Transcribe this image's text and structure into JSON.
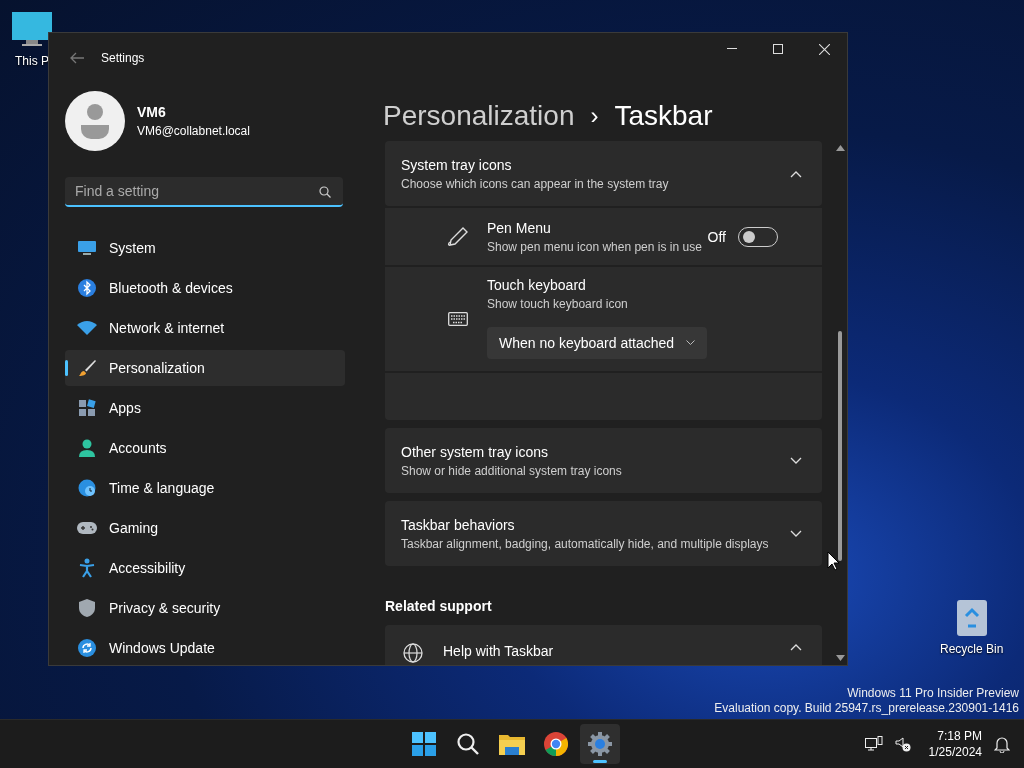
{
  "desktop_icons": [
    {
      "label": "This P"
    },
    {
      "label": "Recycle Bin"
    }
  ],
  "window": {
    "title": "Settings"
  },
  "user": {
    "name": "VM6",
    "email": "VM6@collabnet.local"
  },
  "search": {
    "placeholder": "Find a setting"
  },
  "sidebar": {
    "items": [
      {
        "label": "System",
        "selected": false
      },
      {
        "label": "Bluetooth & devices",
        "selected": false
      },
      {
        "label": "Network & internet",
        "selected": false
      },
      {
        "label": "Personalization",
        "selected": true
      },
      {
        "label": "Apps",
        "selected": false
      },
      {
        "label": "Accounts",
        "selected": false
      },
      {
        "label": "Time & language",
        "selected": false
      },
      {
        "label": "Gaming",
        "selected": false
      },
      {
        "label": "Accessibility",
        "selected": false
      },
      {
        "label": "Privacy & security",
        "selected": false
      },
      {
        "label": "Windows Update",
        "selected": false
      }
    ]
  },
  "breadcrumb": {
    "parent": "Personalization",
    "separator": "›",
    "current": "Taskbar"
  },
  "sections": [
    {
      "title": "System tray icons",
      "subtitle": "Choose which icons can appear in the system tray",
      "expanded": true,
      "children": [
        {
          "kind": "toggle",
          "title": "Pen Menu",
          "subtitle": "Show pen menu icon when pen is in use",
          "state_label": "Off",
          "on": false
        },
        {
          "kind": "dropdown",
          "title": "Touch keyboard",
          "subtitle": "Show touch keyboard icon",
          "value": "When no keyboard attached"
        }
      ]
    },
    {
      "title": "Other system tray icons",
      "subtitle": "Show or hide additional system tray icons",
      "expanded": false
    },
    {
      "title": "Taskbar behaviors",
      "subtitle": "Taskbar alignment, badging, automatically hide, and multiple displays",
      "expanded": false
    }
  ],
  "related_support": {
    "heading": "Related support",
    "items": [
      {
        "title": "Help with Taskbar",
        "expanded": true
      }
    ]
  },
  "desktop_watermark": {
    "line_1": "Windows 11 Pro Insider Preview",
    "line_2": "Evaluation copy. Build 25947.rs_prerelease.230901-1416"
  },
  "taskbar": {
    "apps": [
      {
        "kind": "start",
        "selected": false
      },
      {
        "kind": "search",
        "selected": false
      },
      {
        "kind": "files",
        "selected": false
      },
      {
        "kind": "browser",
        "selected": false
      },
      {
        "kind": "settings",
        "selected": true
      }
    ],
    "clock": {
      "time": "7:18 PM",
      "date": "1/25/2024"
    }
  }
}
